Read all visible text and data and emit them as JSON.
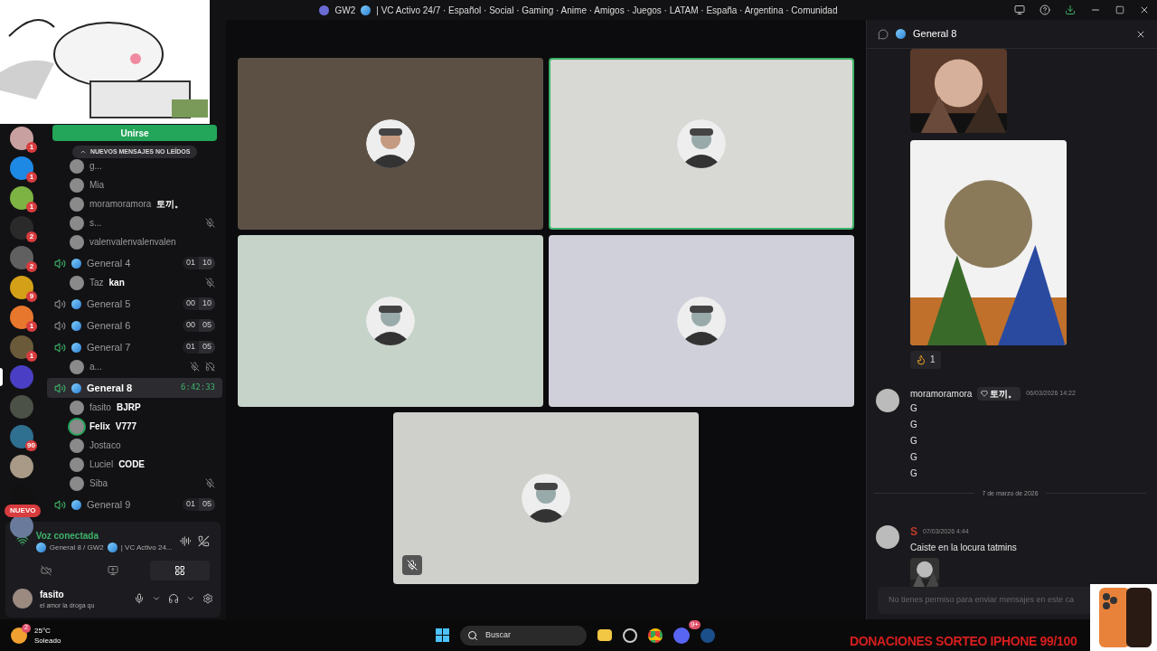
{
  "window": {
    "server": "GW2",
    "title": "| VC Activo 24/7 · Español · Social · Gaming · Anime · Amigos · Juegos · LATAM · España · Argentina · Comunidad"
  },
  "servers": [
    {
      "color": "#c9a0a0",
      "badge": "1",
      "selected": false
    },
    {
      "color": "#1e88e5",
      "badge": "1",
      "selected": false
    },
    {
      "color": "#7cb342",
      "badge": "1",
      "selected": false
    },
    {
      "color": "#2a2a2a",
      "badge": "2",
      "selected": false
    },
    {
      "color": "#606060",
      "badge": "2",
      "selected": false
    },
    {
      "color": "#d4a017",
      "badge": "9",
      "selected": false
    },
    {
      "color": "#e8772e",
      "badge": "1",
      "selected": false
    },
    {
      "color": "#6b5a3a",
      "badge": "1",
      "selected": false
    },
    {
      "color": "#4a3fc4",
      "selected": true
    },
    {
      "color": "#4b5147",
      "selected": false
    },
    {
      "color": "#2f6f8f",
      "badge": "90",
      "selected": false
    },
    {
      "color": "#a89a86",
      "selected": false
    },
    {
      "color": "#111111",
      "selected": false
    },
    {
      "color": "#6a7a9a",
      "selected": false
    }
  ],
  "new_pill": "NUEVO",
  "join_button": "Unirse",
  "unread_pill": "NUEVOS MENSAJES NO LEÍDOS",
  "channel_list": [
    {
      "kind": "user",
      "name": "g...",
      "muted": false,
      "speaking": false
    },
    {
      "kind": "user",
      "name": "Mia",
      "muted": false,
      "speaking": false
    },
    {
      "kind": "user",
      "name": "moramoramora",
      "tag": "토끼。",
      "muted": false,
      "speaking": false
    },
    {
      "kind": "user",
      "name": "s...",
      "muted": true,
      "speaking": false
    },
    {
      "kind": "user",
      "name": "valenvalenvalenvalen",
      "muted": false,
      "speaking": false
    },
    {
      "kind": "channel",
      "name": "General 4",
      "active": true,
      "selected": false,
      "counts": [
        "01",
        "10"
      ]
    },
    {
      "kind": "user",
      "name": "Taz",
      "tag": "kan",
      "muted": true,
      "speaking": false
    },
    {
      "kind": "channel",
      "name": "General 5",
      "active": false,
      "selected": false,
      "counts": [
        "00",
        "10"
      ]
    },
    {
      "kind": "channel",
      "name": "General 6",
      "active": false,
      "selected": false,
      "counts": [
        "00",
        "05"
      ]
    },
    {
      "kind": "channel",
      "name": "General 7",
      "active": true,
      "selected": false,
      "counts": [
        "01",
        "05"
      ]
    },
    {
      "kind": "user",
      "name": "a...",
      "muted": true,
      "deafened": true,
      "speaking": false
    },
    {
      "kind": "channel",
      "name": "General 8",
      "active": true,
      "selected": true,
      "timer": "6:42:33"
    },
    {
      "kind": "user",
      "name": "fasito",
      "tag": "BJRP",
      "muted": false,
      "speaking": false
    },
    {
      "kind": "user",
      "name": "Felix",
      "tag": "V777",
      "muted": false,
      "speaking": true
    },
    {
      "kind": "user",
      "name": "Jostaco",
      "muted": false,
      "speaking": false
    },
    {
      "kind": "user",
      "name": "Luciel",
      "tag": "CODE",
      "muted": false,
      "speaking": false
    },
    {
      "kind": "user",
      "name": "Siba",
      "muted": true,
      "speaking": false
    },
    {
      "kind": "channel",
      "name": "General 9",
      "active": true,
      "selected": false,
      "counts": [
        "01",
        "05"
      ]
    }
  ],
  "voice_panel": {
    "status": "Voz conectada",
    "location": "General 8 / GW2",
    "server_name": "| VC Activo 24..."
  },
  "user_panel": {
    "name": "fasito",
    "status": "el amor la droga qu"
  },
  "tiles": [
    {
      "color": "#5c5045",
      "speaking": false,
      "muted": false
    },
    {
      "color": "#d8d8d5",
      "speaking": true,
      "muted": false
    },
    {
      "color": "#c6d3c9",
      "speaking": false,
      "muted": false
    },
    {
      "color": "#cfd0d9",
      "speaking": false,
      "muted": false
    },
    {
      "color": "#cfcfcc",
      "speaking": false,
      "muted": true
    }
  ],
  "chat": {
    "title": "General 8",
    "reaction": {
      "count": "1"
    },
    "messages": [
      {
        "author": "moramoramora",
        "tag": "토끼。",
        "time": "06/03/2026 14:22",
        "lines": [
          "G",
          "G",
          "G",
          "G",
          "G"
        ]
      },
      {
        "kind": "divider",
        "text": "7 de marzo de 2026"
      },
      {
        "author": "S",
        "color": "#c0392b",
        "time": "07/03/2026 4:44",
        "lines": [
          "Caiste en la locura tatmins"
        ],
        "attachment": true
      }
    ],
    "placeholder": "No tienes permiso para enviar mensajes en este ca"
  },
  "taskbar": {
    "temperature": "25°C",
    "weather": "Soleado",
    "weather_badge": "2",
    "search_placeholder": "Buscar",
    "discord_badge": "9+"
  },
  "overlay": {
    "banner": "DONACIONES SORTEO IPHONE 99/100"
  }
}
